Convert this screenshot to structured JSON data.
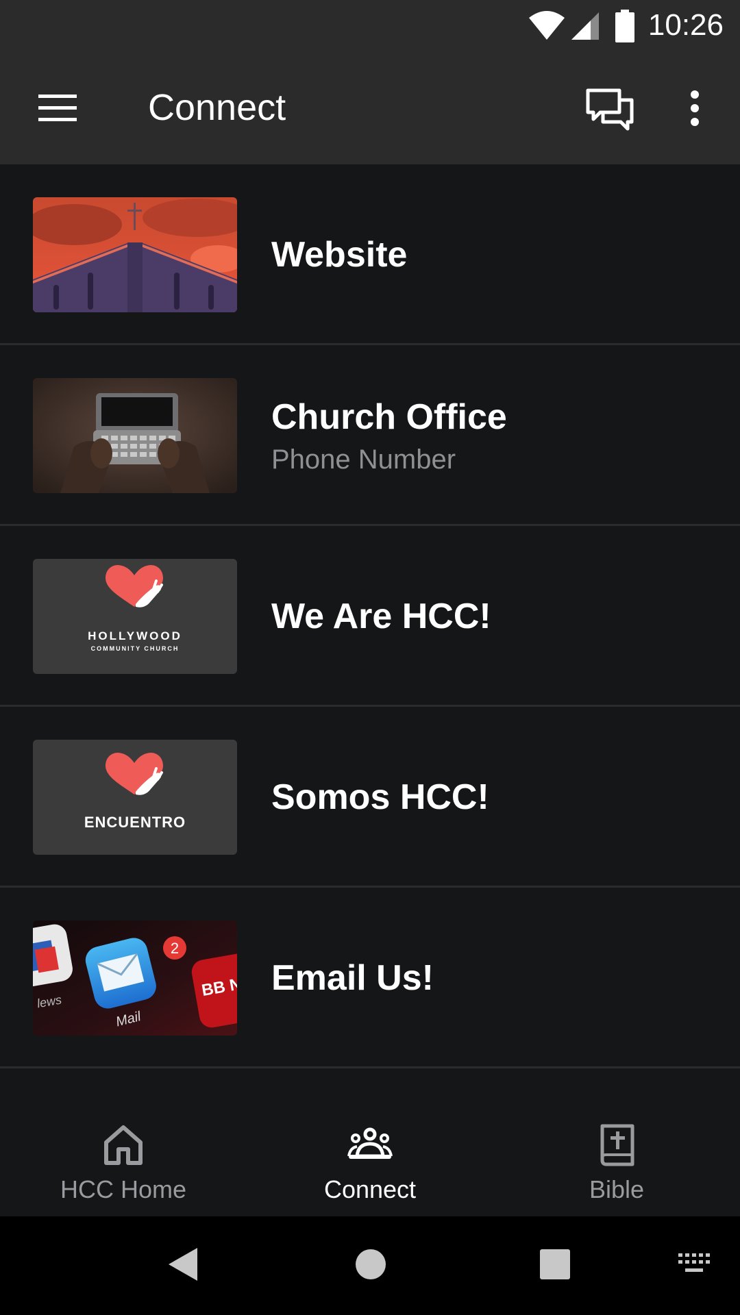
{
  "status_bar": {
    "time": "10:26"
  },
  "app_bar": {
    "title": "Connect"
  },
  "list": {
    "items": [
      {
        "label": "Website",
        "sublabel": "",
        "thumb": "church-building-image"
      },
      {
        "label": "Church Office",
        "sublabel": "Phone Number",
        "thumb": "hands-holding-phone-image"
      },
      {
        "label": "We Are HCC!",
        "sublabel": "",
        "thumb": "hollywood-community-church-logo",
        "logo_line1": "HOLLYWOOD",
        "logo_line2": "COMMUNITY CHURCH"
      },
      {
        "label": "Somos HCC!",
        "sublabel": "",
        "thumb": "encuentro-logo",
        "logo_line1": "ENCUENTRO"
      },
      {
        "label": "Email Us!",
        "sublabel": "",
        "thumb": "mail-app-icon-image",
        "app_label": "Mail",
        "badge": "2",
        "left_app_label": "lews",
        "right_app_label": "BB NEV"
      }
    ]
  },
  "bottom_nav": {
    "items": [
      {
        "label": "HCC Home",
        "icon": "home-icon",
        "selected": false
      },
      {
        "label": "Connect",
        "icon": "people-icon",
        "selected": true
      },
      {
        "label": "Bible",
        "icon": "bible-icon",
        "selected": false
      }
    ]
  },
  "colors": {
    "app_bar_bg": "#2b2b2c",
    "page_bg": "#151618",
    "heart": "#ef5b57",
    "nav_selected": "#ffffff",
    "nav_unselected": "#9a9b9e"
  }
}
